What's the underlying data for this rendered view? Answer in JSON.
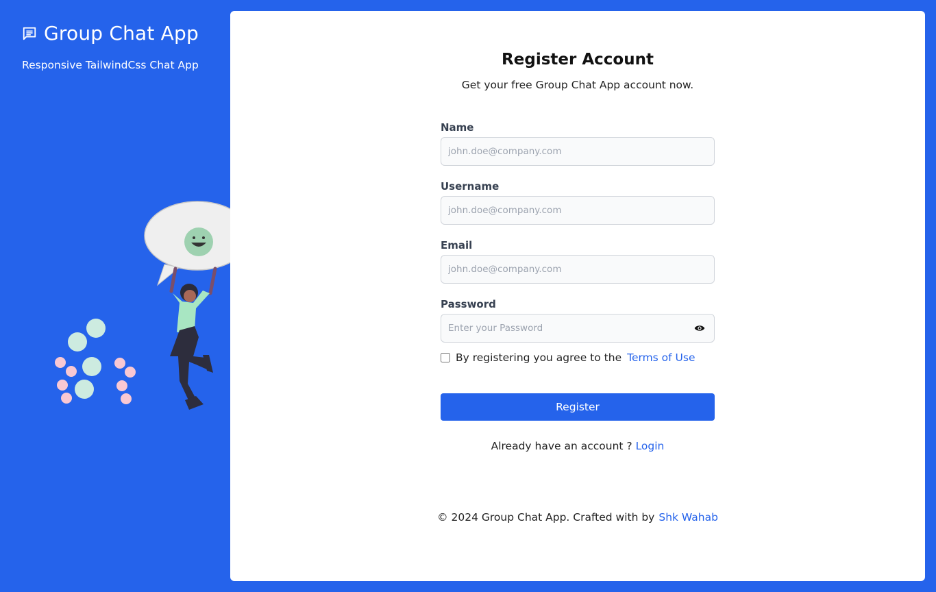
{
  "brand": {
    "title": "Group Chat App",
    "tagline": "Responsive TailwindCss Chat App"
  },
  "form": {
    "heading": "Register Account",
    "subheading": "Get your free Group Chat App account now.",
    "fields": [
      {
        "label": "Name",
        "placeholder": "john.doe@company.com",
        "value": ""
      },
      {
        "label": "Username",
        "placeholder": "john.doe@company.com",
        "value": ""
      },
      {
        "label": "Email",
        "placeholder": "john.doe@company.com",
        "value": ""
      },
      {
        "label": "Password",
        "placeholder": "Enter your Password",
        "value": ""
      }
    ],
    "terms_text": "By registering you agree to the",
    "terms_link": "Terms of Use",
    "submit_label": "Register",
    "login_prompt": "Already have an account ?",
    "login_link": "Login"
  },
  "footer": {
    "text": "© 2024 Group Chat App. Crafted with by",
    "author": "Shk Wahab"
  },
  "colors": {
    "primary": "#2563eb",
    "card": "#ffffff",
    "input_bg": "#f9fafb"
  },
  "icons": {
    "brand": "chat-bubble-icon",
    "password_toggle": "eye-icon"
  }
}
